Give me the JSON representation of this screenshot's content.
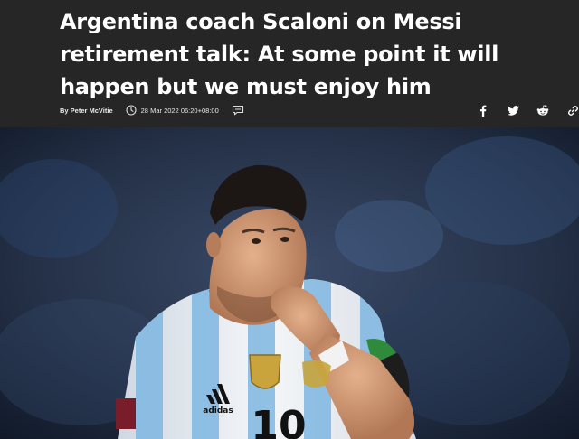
{
  "article": {
    "title": "Argentina coach Scaloni on Messi retirement talk: At some point it will happen but we must enjoy him",
    "byline": "By Peter McVitie",
    "date": "28 Mar 2022 06:20+08:00"
  },
  "share_icons": [
    "facebook-icon",
    "twitter-icon",
    "reddit-icon",
    "link-icon"
  ],
  "photo": {
    "sponsor_logo": "adidas",
    "jersey_number": "10"
  },
  "colors": {
    "header_bg": "#262626",
    "title_text": "#ffffff",
    "jersey_blue": "#7eb6e0"
  }
}
